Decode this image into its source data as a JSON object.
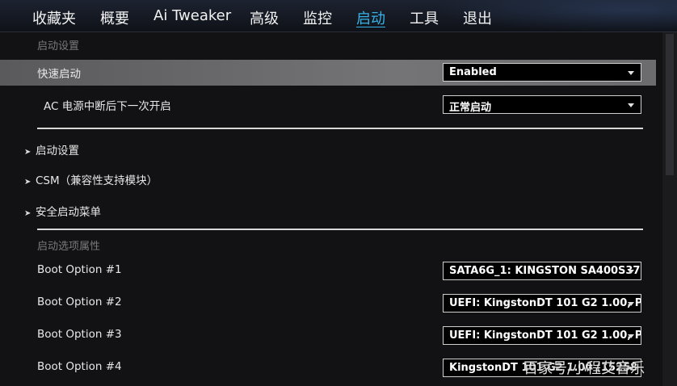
{
  "tabs": [
    {
      "label": "收藏夹"
    },
    {
      "label": "概要"
    },
    {
      "label": "Ai Tweaker"
    },
    {
      "label": "高级"
    },
    {
      "label": "监控"
    },
    {
      "label": "启动"
    },
    {
      "label": "工具"
    },
    {
      "label": "退出"
    }
  ],
  "active_tab": "启动",
  "sections": {
    "boot_config": "启动设置",
    "boot_option_priorities": "启动选项属性"
  },
  "settings": {
    "fast_boot": {
      "label": "快速启动",
      "value": "Enabled"
    },
    "ac_power_loss": {
      "label": "AC 电源中断后下一次开启",
      "value": "正常启动"
    }
  },
  "submenus": [
    {
      "label": "启动设置"
    },
    {
      "label": "CSM（兼容性支持模块）"
    },
    {
      "label": "安全启动菜单"
    }
  ],
  "boot_options": [
    {
      "label": "Boot Option #1",
      "value": "SATA6G_1: KINGSTON SA400S37"
    },
    {
      "label": "Boot Option #2",
      "value": "UEFI: KingstonDT 101 G2 1.00, P"
    },
    {
      "label": "Boot Option #3",
      "value": "UEFI: KingstonDT 101 G2 1.00, P"
    },
    {
      "label": "Boot Option #4",
      "value": "KingstonDT 101 G2 1.00 (15258"
    }
  ],
  "watermark": "百家号/小程艾音乐",
  "colors": {
    "accent": "#36b3e8",
    "highlight_row": "#6c6c6e",
    "background": "#121214"
  }
}
